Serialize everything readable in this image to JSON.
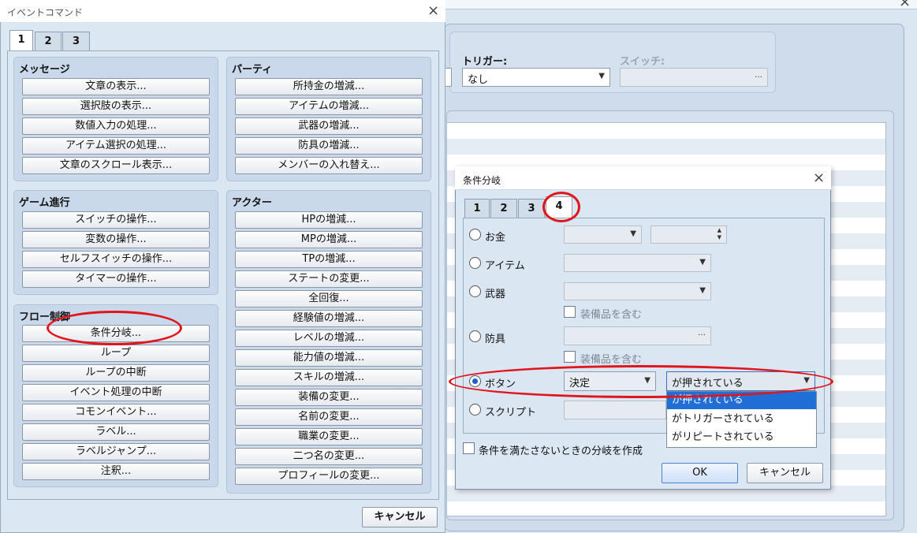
{
  "background_editor": {
    "trigger_label": "トリガー:",
    "trigger_value": "なし",
    "switch_label": "スイッチ:",
    "switch_button": "…"
  },
  "event_command": {
    "title": "イベントコマンド",
    "tabs": [
      "1",
      "2",
      "3"
    ],
    "groups": {
      "message": {
        "title": "メッセージ",
        "buttons": [
          "文章の表示...",
          "選択肢の表示...",
          "数値入力の処理...",
          "アイテム選択の処理...",
          "文章のスクロール表示..."
        ]
      },
      "party": {
        "title": "パーティ",
        "buttons": [
          "所持金の増減...",
          "アイテムの増減...",
          "武器の増減...",
          "防具の増減...",
          "メンバーの入れ替え..."
        ]
      },
      "game_progress": {
        "title": "ゲーム進行",
        "buttons": [
          "スイッチの操作...",
          "変数の操作...",
          "セルフスイッチの操作...",
          "タイマーの操作..."
        ]
      },
      "actor": {
        "title": "アクター",
        "buttons": [
          "HPの増減...",
          "MPの増減...",
          "TPの増減...",
          "ステートの変更...",
          "全回復...",
          "経験値の増減...",
          "レベルの増減...",
          "能力値の増減...",
          "スキルの増減...",
          "装備の変更...",
          "名前の変更...",
          "職業の変更...",
          "二つ名の変更...",
          "プロフィールの変更..."
        ]
      },
      "flow": {
        "title": "フロー制御",
        "buttons": [
          "条件分岐...",
          "ループ",
          "ループの中断",
          "イベント処理の中断",
          "コモンイベント...",
          "ラベル...",
          "ラベルジャンプ...",
          "注釈..."
        ]
      }
    },
    "cancel": "キャンセル"
  },
  "conditional_branch": {
    "title": "条件分岐",
    "tabs": [
      "1",
      "2",
      "3",
      "4"
    ],
    "active_tab": "4",
    "money_label": "お金",
    "item_label": "アイテム",
    "weapon_label": "武器",
    "weapon_include_equip": "装備品を含む",
    "armor_label": "防具",
    "armor_button": "…",
    "armor_include_equip": "装備品を含む",
    "button_label": "ボタン",
    "button_key_value": "決定",
    "button_state_value": "が押されている",
    "button_state_options": [
      "が押されている",
      "がトリガーされている",
      "がリピートされている"
    ],
    "script_label": "スクリプト",
    "else_branch_label": "条件を満たさないときの分岐を作成",
    "ok": "OK",
    "cancel": "キャンセル"
  },
  "colors": {
    "annotation": "#e2151c",
    "selection": "#1f6fd6"
  }
}
